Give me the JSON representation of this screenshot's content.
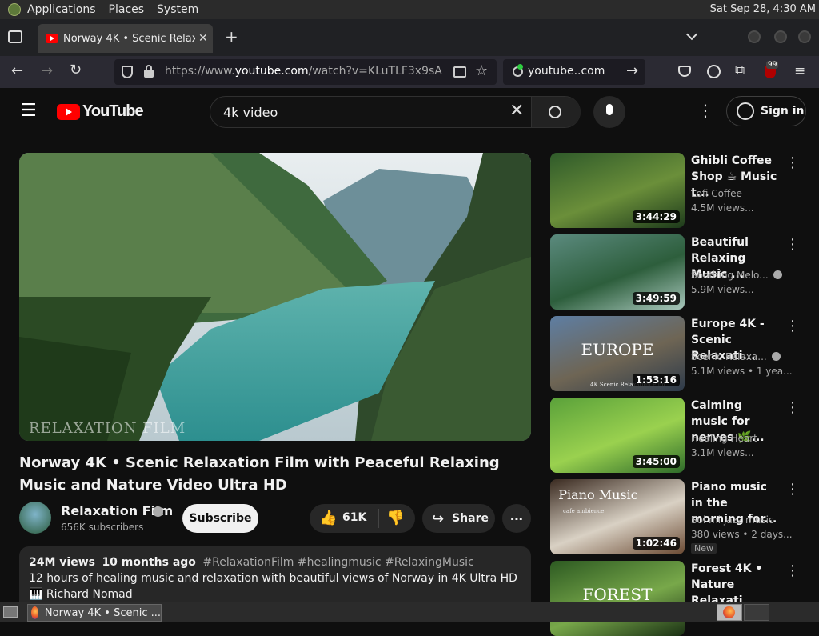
{
  "desktop": {
    "menu": [
      "Applications",
      "Places",
      "System"
    ],
    "clock": "Sat Sep 28,  4:30 AM"
  },
  "browser": {
    "tab_title": "Norway 4K • Scenic Relaxati",
    "url_prefix": "https://www.",
    "url_domain": "youtube.com",
    "url_path": "/watch?v=KLuTLF3x9sA",
    "search_engine_text": "youtube..com",
    "extension_badge": "99"
  },
  "youtube": {
    "logo_text": "YouTube",
    "search_value": "4k video",
    "sign_in": "Sign in",
    "video": {
      "watermark": "RELAXATION FILM",
      "title": "Norway 4K • Scenic Relaxation Film with Peaceful Relaxing Music and Nature Video Ultra HD",
      "channel": "Relaxation Film",
      "subscribers": "656K subscribers",
      "subscribe": "Subscribe",
      "likes": "61K",
      "share": "Share",
      "views": "24M views",
      "age": "10 months ago",
      "hashtags": "#RelaxationFilm #healingmusic #RelaxingMusic",
      "description": "12 hours of healing music and relaxation with beautiful views of Norway in 4K Ultra HD",
      "author_line": "🎹 Richard Nomad"
    },
    "recommendations": [
      {
        "title": "Ghibli Coffee Shop ☕ Music t...",
        "channel": "Lofi Coffee",
        "views": "4.5M views...",
        "duration": "3:44:29",
        "colors": [
          "#2f5a2a",
          "#6b8f3a",
          "#1d3a1b"
        ]
      },
      {
        "title": "Beautiful Relaxing Music ...",
        "channel": "Soothing Melo...",
        "views": "5.9M views...",
        "duration": "3:49:59",
        "colors": [
          "#5b8a7e",
          "#2d5e3c",
          "#a8c7bc"
        ]
      },
      {
        "title": "Europe 4K - Scenic Relaxati...",
        "channel": "Scenic Relaxa...",
        "views": "5.1M views  • 1 yea...",
        "duration": "1:53:16",
        "overlay": "EUROPE",
        "sub_overlay": "4K Scenic Relaxation Film",
        "colors": [
          "#5e7ea3",
          "#6e6554",
          "#2d3a4a"
        ]
      },
      {
        "title": "Calming music for nerves 🌿...",
        "channel": "Healing Heart",
        "views": "3.1M views...",
        "duration": "3:45:00",
        "colors": [
          "#5aa13a",
          "#9ad14f",
          "#2e6b2a"
        ]
      },
      {
        "title": "Piano music in the morning for...",
        "channel": "Sol mi jazz music",
        "views": "380 views  • 2 days...",
        "duration": "1:02:46",
        "badge": "New",
        "overlay": "Piano Music",
        "sub_overlay": "cafe ambience",
        "colors": [
          "#3a2a20",
          "#d9d1c4",
          "#6b4a33"
        ]
      },
      {
        "title": "Forest 4K • Nature Relaxati...",
        "channel": "",
        "views": "",
        "duration": "",
        "overlay": "FOREST",
        "colors": [
          "#2d5a22",
          "#78a84a",
          "#1a3014"
        ]
      }
    ]
  },
  "taskbar": {
    "task_title": "Norway 4K • Scenic ..."
  }
}
